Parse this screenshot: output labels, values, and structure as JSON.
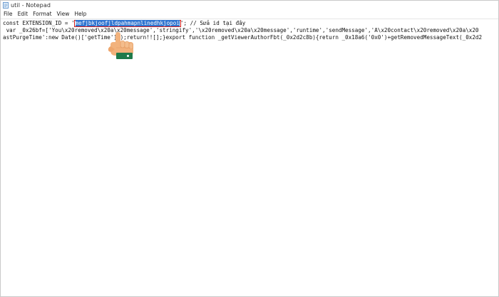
{
  "window": {
    "title": "util - Notepad",
    "icon": "notepad-icon"
  },
  "menu": [
    {
      "label": "File"
    },
    {
      "label": "Edit"
    },
    {
      "label": "Format"
    },
    {
      "label": "View"
    },
    {
      "label": "Help"
    }
  ],
  "editor": {
    "line1": {
      "prefix": "const EXTENSION_ID = '",
      "highlight": "mefjbkjoofjldpahmapnlinedhkjopoi",
      "suffix": "'; // Sửa id tại đây"
    },
    "line2": " var _0x26bf=['You\\x20removed\\x20a\\x20message','stringify','\\x20removed\\x20a\\x20message','runtime','sendMessage','A\\x20contact\\x20removed\\x20a\\x20",
    "line3": "astPurgeTime':new Date()['getTime']();return!![];}export function _getViewerAuthorFbt(_0x2d2c8b){return _0x18a6('0x0')+getRemovedMessageText(_0x2d2"
  },
  "overlay": {
    "cursor": "hand-pointer-icon",
    "badge_color": "#1f7a4a",
    "highlight_border_color": "#d11c1c",
    "selection_color": "#2f74d0"
  }
}
